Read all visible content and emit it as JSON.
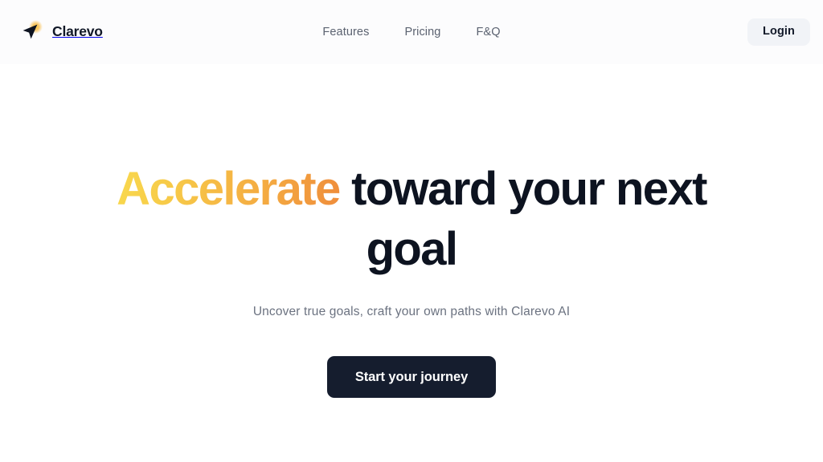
{
  "header": {
    "brand": {
      "name": "Clarevo",
      "logo_icon": "navigation-arrow-icon",
      "logo_arrow_color": "#0d1320",
      "logo_glow_color": "#f7c948"
    },
    "nav_items": [
      {
        "label": "Features"
      },
      {
        "label": "Pricing"
      },
      {
        "label": "F&Q"
      }
    ],
    "login_button": {
      "label": "Login",
      "background": "#f1f3f7",
      "text_color": "#131a2a"
    }
  },
  "hero": {
    "title_accent": "Accelerate",
    "title_rest": " toward your next goal",
    "title_full": "Accelerate toward your next goal",
    "subtitle": "Uncover true goals, craft your own paths with Clarevo AI",
    "cta_label": "Start your journey",
    "colors": {
      "gradient_start": "#f8d84d",
      "gradient_end": "#ef8d3b",
      "title_color": "#0d1320",
      "subtitle_color": "#6b7280",
      "cta_background": "#151d2e",
      "cta_text": "#ffffff",
      "page_background": "#ffffff"
    }
  }
}
